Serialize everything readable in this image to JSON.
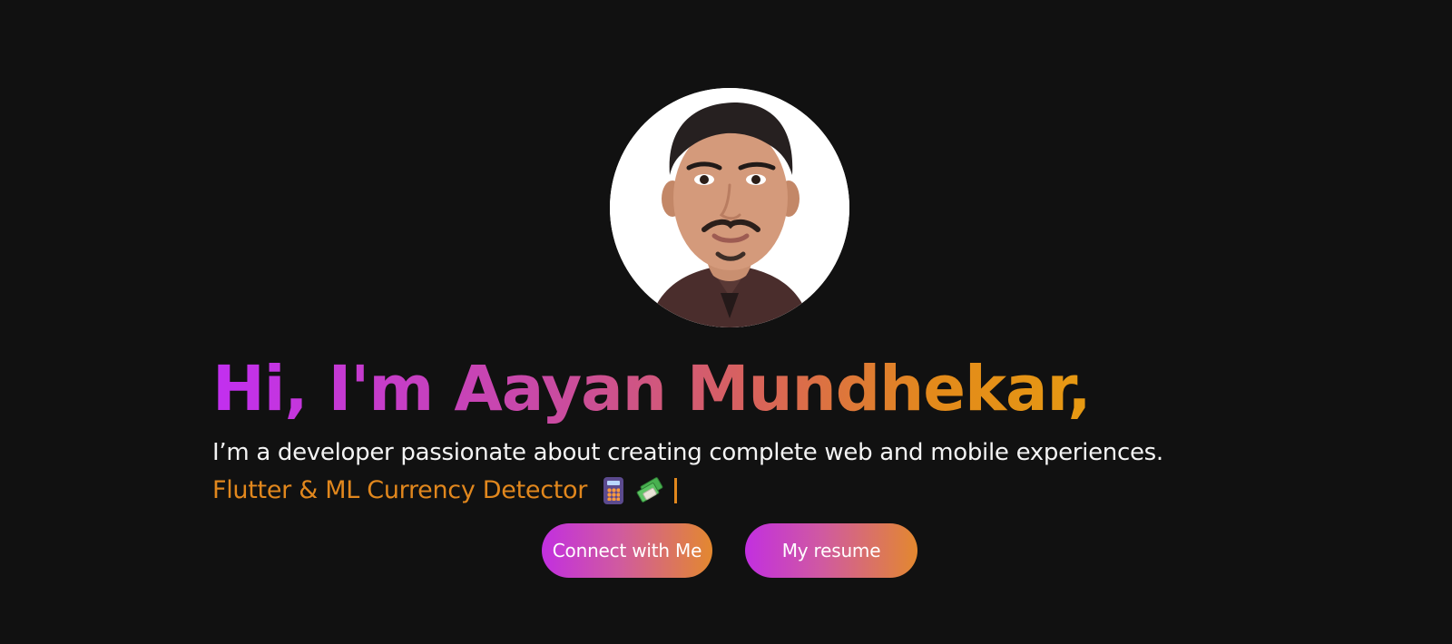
{
  "hero": {
    "headline": "Hi, I'm Aayan Mundhekar,",
    "tagline": "I’m a developer passionate about creating complete web and mobile experiences.",
    "typed_text": "Flutter & ML Currency Detector",
    "typed_icons": [
      "calculator-icon",
      "money-with-wings-icon"
    ],
    "cursor": "|",
    "colors": {
      "background": "#111111",
      "gradient_start": "#c22ff0",
      "gradient_end": "#e69a12",
      "typed_text": "#e1871d",
      "body_text": "#f4f4f4"
    }
  },
  "buttons": {
    "connect_label": "Connect with Me",
    "resume_label": "My resume"
  }
}
